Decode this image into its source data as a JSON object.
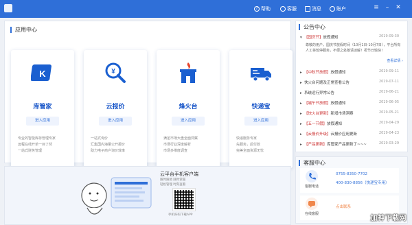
{
  "titlebar": {
    "help": "帮助",
    "service": "客服",
    "message": "消息",
    "account": "账户"
  },
  "apps_panel": {
    "title": "应用中心",
    "apps": [
      {
        "name": "库管家",
        "button": "进入应用",
        "desc": [
          "专业的智能库存管理专家",
          "远程在线开单一目了然",
          "一站式财务管理"
        ]
      },
      {
        "name": "云报价",
        "button": "进入应用",
        "desc": [
          "一站式询价",
          "汇集国内海量公开报价",
          "助力电子商户询价效率"
        ]
      },
      {
        "name": "烽火台",
        "button": "进入应用",
        "desc": [
          "满足市场大盘全面洞察",
          "市场行业深度解析",
          "市场多维度调查"
        ]
      },
      {
        "name": "快递宝",
        "button": "进入应用",
        "desc": [
          "快递服务专家",
          "先服务，后付款",
          "完美全面资源无忧"
        ]
      }
    ]
  },
  "mobile": {
    "title": "云平台手机客户端",
    "sub1": "随时随地 随时掌握",
    "sub2": "轻松管理 时刻查看",
    "qr_caption": "手机扫码下载APP"
  },
  "notice": {
    "title": "公告中心",
    "items": [
      {
        "tag": "【国庆节】",
        "text": "放假通知",
        "date": "2019-09-30"
      },
      {
        "tag": "【中秋节放假】",
        "text": "放假通知",
        "date": "2019-09-11"
      },
      {
        "tag": "",
        "text": "快火台问题及正常查看公告",
        "date": "2019-07-11"
      },
      {
        "tag": "",
        "text": "系统运行异常公告",
        "date": "2019-06-21"
      },
      {
        "tag": "【端午节放假】",
        "text": "放假通知",
        "date": "2019-06-05"
      },
      {
        "tag": "【快火台更新】",
        "text": "新增市场洞察",
        "date": "2019-05-21"
      },
      {
        "tag": "【五一节假】",
        "text": "放假通知",
        "date": "2019-04-29"
      },
      {
        "tag": "【云报价升级】",
        "text": "云报价应用更新",
        "date": "2019-04-23"
      },
      {
        "tag": "【产品更新】",
        "text": "库管家产品更新了~~~",
        "date": "2019-03-29"
      }
    ],
    "detail": "尊敬的用户，国庆节放假时间（10月1日-10月7日），平台所有人工将暂停服务，不便之处敬请谅解！祝节日愉快！",
    "more": "查看详情 ›"
  },
  "service": {
    "title": "客服中心",
    "phone_label": "客服电话",
    "phone1": "0755-8350-7702",
    "phone2": "400-830-8856（快递宝专用）",
    "online_label": "在线客服",
    "online_text": "点击联系"
  },
  "watermark": "加神下载网",
  "colors": {
    "brand": "#2f6fd8",
    "accent_red": "#c33",
    "bg": "#eef1f6"
  }
}
